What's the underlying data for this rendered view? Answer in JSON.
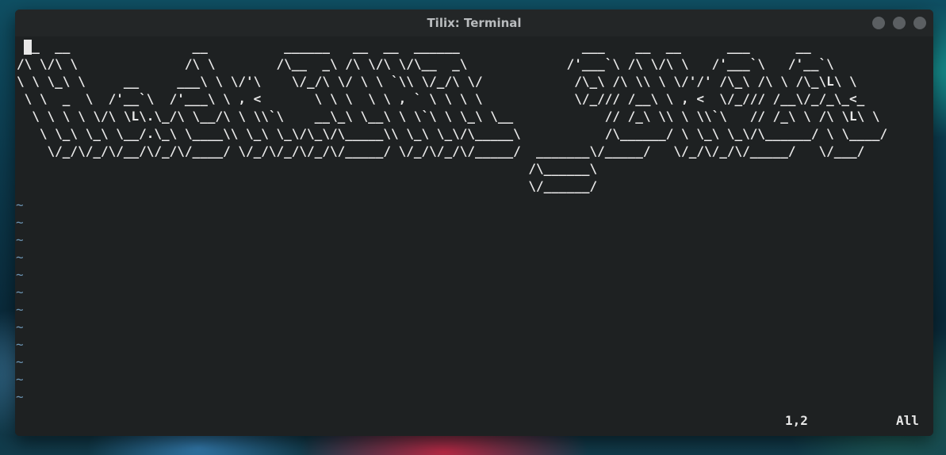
{
  "window": {
    "title": "Tilix: Terminal",
    "buttons": [
      "minimize",
      "maximize",
      "close"
    ]
  },
  "terminal": {
    "ascii_art": " __  __                __          ______   __  __  ______                ___    __  __      ___      __\n/\\ \\/\\ \\              /\\ \\        /\\__  _\\ /\\ \\/\\ \\/\\__  _\\             /'___`\\ /\\ \\/\\ \\   /'___`\\   /'__`\\\n\\ \\ \\_\\ \\     __     ___\\ \\ \\/'\\    \\/_/\\ \\/ \\ \\ `\\\\ \\/_/\\ \\/            /\\_\\ /\\ \\\\ \\ \\/'/' /\\_\\ /\\ \\ /\\_\\L\\ \\\n \\ \\  _  \\  /'__`\\  /'___\\ \\ , <       \\ \\ \\  \\ \\ , ` \\ \\ \\ \\            \\/_/// /__\\ \\ , <  \\/_/// /__\\/_/_\\_<_\n  \\ \\ \\ \\ \\/\\ \\L\\.\\_/\\ \\__/\\ \\ \\\\`\\    __\\_\\ \\__\\ \\ \\`\\ \\ \\_\\ \\__            // /_\\ \\\\ \\ \\\\`\\   // /_\\ \\ /\\ \\L\\ \\\n   \\ \\_\\ \\_\\ \\__/.\\_\\ \\____\\\\ \\_\\ \\_\\/\\_\\/\\_____\\\\ \\_\\ \\_\\/\\_____\\           /\\______/ \\ \\_\\ \\_\\/\\______/ \\ \\____/\n    \\/_/\\/_/\\/__/\\/_/\\/____/ \\/_/\\/_/\\/_/\\/_____/ \\/_/\\/_/\\/_____/  _______\\/_____/   \\/_/\\/_/\\/_____/   \\/___/\n                                                                   /\\______\\\n                                                                   \\/______/",
    "tildes": "~\n~\n~\n~\n~\n~\n~\n~\n~\n~\n~\n~",
    "status_position": "1,2",
    "status_scroll": "All"
  },
  "colors": {
    "terminal_bg": "#1e2122",
    "titlebar_bg": "#232627",
    "text": "#e8e8e8",
    "tilde": "#6b95b5"
  }
}
